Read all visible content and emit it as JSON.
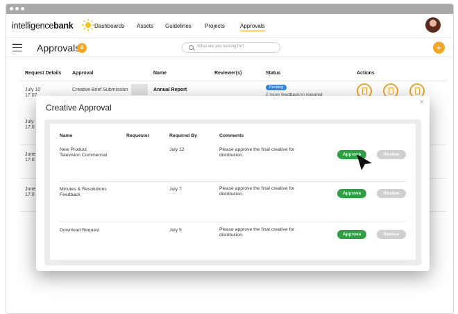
{
  "brand": {
    "logo_regular": "intelligence",
    "logo_bold": "bank",
    "accent_color": "#f5a623"
  },
  "nav": {
    "items": [
      {
        "label": "Dashboards"
      },
      {
        "label": "Assets"
      },
      {
        "label": "Guidelines"
      },
      {
        "label": "Projects"
      },
      {
        "label": "Approvals",
        "active": true
      }
    ]
  },
  "subheader": {
    "title": "Approvals",
    "count": "4",
    "search_placeholder": "What are you looking for?"
  },
  "table": {
    "headers": [
      "Request Details",
      "Approval",
      "Name",
      "Reviewer(s)",
      "Status",
      "Actions"
    ],
    "rows": [
      {
        "date": "July 10",
        "time": "17:07",
        "approval": "Creative Brief Submission",
        "name": "Annual Report",
        "status": "Pending",
        "status_note": "2 more feedback(s) required"
      },
      {
        "date": "July",
        "time": "17:0"
      },
      {
        "date": "June",
        "time": "17:0"
      },
      {
        "date": "June",
        "time": "17:0"
      }
    ]
  },
  "modal": {
    "title": "Creative Approval",
    "close_icon": "×",
    "headers": {
      "name": "Name",
      "requester": "Requester",
      "required_by": "Required By",
      "comments": "Comments"
    },
    "approve_label": "Approve",
    "review_label": "Review",
    "rows": [
      {
        "name_line1": "New Product",
        "name_line2": "Television Commercial",
        "required_by": "July 12",
        "comment_line1": "Please approve the final creative for",
        "comment_line2": "distribution."
      },
      {
        "name_line1": "Minutes & Resolutions",
        "name_line2": "Feedback",
        "required_by": "July 7",
        "comment_line1": "Please approve the final creative for",
        "comment_line2": "distribution."
      },
      {
        "name_line1": "Download Request",
        "name_line2": "",
        "required_by": "July 5",
        "comment_line1": "Please approve the final creative for",
        "comment_line2": "distribution."
      }
    ]
  }
}
